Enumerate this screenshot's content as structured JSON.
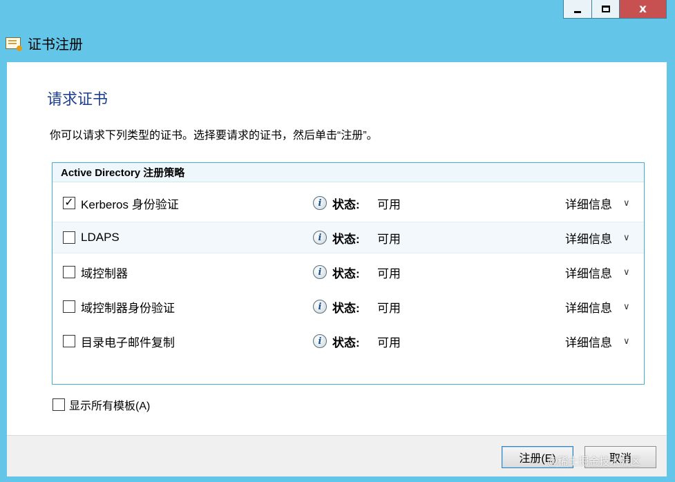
{
  "window": {
    "title": "证书注册",
    "caption_buttons": {
      "minimize": "minimize",
      "maximize": "maximize",
      "close": "x"
    }
  },
  "page": {
    "heading": "请求证书",
    "instruction": "你可以请求下列类型的证书。选择要请求的证书，然后单击“注册”。"
  },
  "policy": {
    "header": "Active Directory 注册策略",
    "status_label": "状态:",
    "details_label": "详细信息",
    "rows": [
      {
        "name": "Kerberos 身份验证",
        "checked": true,
        "check_mark": "✓",
        "status": "可用"
      },
      {
        "name": "LDAPS",
        "checked": false,
        "check_mark": "",
        "status": "可用"
      },
      {
        "name": "域控制器",
        "checked": false,
        "check_mark": "",
        "status": "可用"
      },
      {
        "name": "域控制器身份验证",
        "checked": false,
        "check_mark": "",
        "status": "可用"
      },
      {
        "name": "目录电子邮件复制",
        "checked": false,
        "check_mark": "",
        "status": "可用"
      }
    ]
  },
  "show_all_templates": {
    "label": "显示所有模板(A)",
    "checked": false
  },
  "buttons": {
    "enroll": "注册(E)",
    "cancel": "取消"
  },
  "watermark": "@稀土掘金技术社区",
  "icons": {
    "window": "certificate-icon",
    "info": "info-icon",
    "expand": "chevron-down-icon"
  },
  "colors": {
    "frame": "#63c6e9",
    "heading": "#1e3f8f",
    "panel_border": "#3eaed5",
    "close": "#c75050"
  }
}
